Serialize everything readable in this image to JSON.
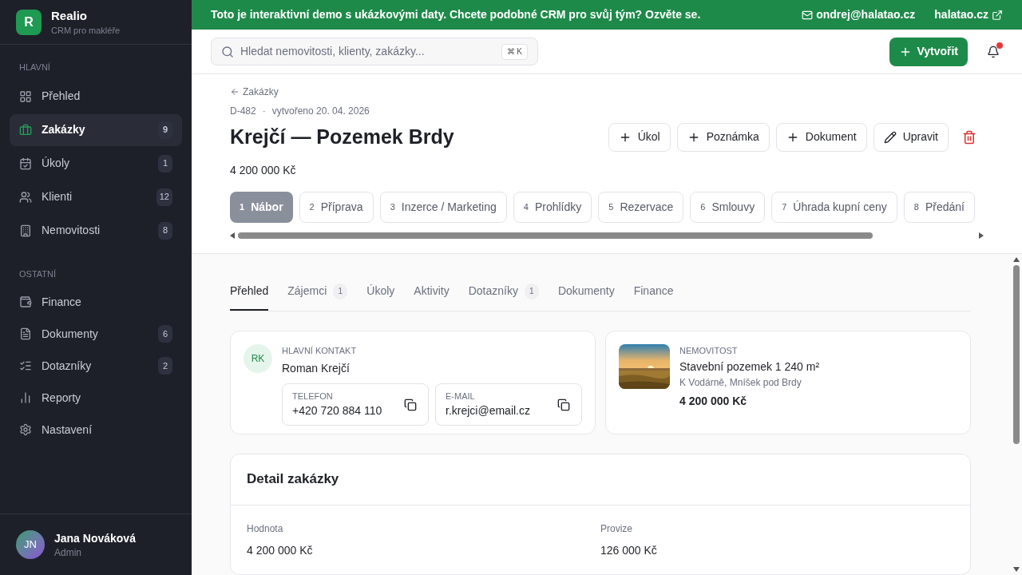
{
  "brand": {
    "logo": "R",
    "name": "Realio",
    "subtitle": "CRM pro makléře"
  },
  "sidebar": [
    {
      "heading": "HLAVNÍ",
      "items": [
        {
          "label": "Přehled",
          "selected": false
        },
        {
          "label": "Zakázky",
          "count": "9",
          "selected": true
        },
        {
          "label": "Úkoly",
          "count": "1",
          "selected": false
        },
        {
          "label": "Klienti",
          "count": "12",
          "selected": false
        },
        {
          "label": "Nemovitosti",
          "count": "8",
          "selected": false
        }
      ]
    },
    {
      "heading": "OSTATNÍ",
      "items": [
        {
          "label": "Finance",
          "selected": false
        },
        {
          "label": "Dokumenty",
          "count": "6",
          "selected": false
        },
        {
          "label": "Dotazníky",
          "count": "2",
          "selected": false
        },
        {
          "label": "Reporty",
          "selected": false
        },
        {
          "label": "Nastavení",
          "selected": false
        }
      ]
    }
  ],
  "user": {
    "initials": "JN",
    "name": "Jana Nováková",
    "role": "Admin"
  },
  "banner": {
    "text": "Toto je interaktivní demo s ukázkovými daty. Chcete podobné CRM pro svůj tým? Ozvěte se.",
    "email": "ondrej@halatao.cz",
    "link": "halatao.cz"
  },
  "search": {
    "placeholder": "Hledat nemovitosti, klienty, zakázky...",
    "shortcut_symbol": "⌘",
    "shortcut_key": "K"
  },
  "create_button": "Vytvořit",
  "notifications": {
    "unread": true
  },
  "breadcrumb": "Zakázky",
  "deal": {
    "id": "D-482",
    "separator": "·",
    "created": "vytvořeno 20. 04. 2026",
    "title": "Krejčí — Pozemek Brdy",
    "price": "4 200 000 Kč"
  },
  "actions": [
    {
      "kind": "add",
      "label": "Úkol"
    },
    {
      "kind": "add",
      "label": "Poznámka"
    },
    {
      "kind": "add",
      "label": "Dokument"
    },
    {
      "kind": "edit",
      "label": "Upravit"
    },
    {
      "kind": "delete"
    }
  ],
  "stages": [
    {
      "number": "1",
      "label": "Nábor",
      "selected": true
    },
    {
      "number": "2",
      "label": "Příprava",
      "selected": false
    },
    {
      "number": "3",
      "label": "Inzerce / Marketing",
      "selected": false
    },
    {
      "number": "4",
      "label": "Prohlídky",
      "selected": false
    },
    {
      "number": "5",
      "label": "Rezervace",
      "selected": false
    },
    {
      "number": "6",
      "label": "Smlouvy",
      "selected": false
    },
    {
      "number": "7",
      "label": "Úhrada kupní ceny",
      "selected": false
    },
    {
      "number": "8",
      "label": "Předání",
      "selected": false
    }
  ],
  "tabs": [
    {
      "label": "Přehled",
      "selected": true
    },
    {
      "label": "Zájemci",
      "count": "1",
      "selected": false
    },
    {
      "label": "Úkoly",
      "selected": false
    },
    {
      "label": "Aktivity",
      "selected": false
    },
    {
      "label": "Dotazníky",
      "count": "1",
      "selected": false
    },
    {
      "label": "Dokumenty",
      "selected": false
    },
    {
      "label": "Finance",
      "selected": false
    }
  ],
  "contact": {
    "initials": "RK",
    "heading": "HLAVNÍ KONTAKT",
    "name": "Roman Krejčí",
    "fields": [
      {
        "label": "TELEFON",
        "value": "+420 720 884 110"
      },
      {
        "label": "E-MAIL",
        "value": "r.krejci@email.cz"
      }
    ]
  },
  "property": {
    "kind": "picture",
    "heading": "NEMOVITOST",
    "title": "Stavební pozemek 1 240 m²",
    "address": "K Vodárně, Mníšek pod Brdy",
    "price": "4 200 000 Kč"
  },
  "detail": {
    "title": "Detail zakázky",
    "fields": [
      {
        "label": "Hodnota",
        "value": "4 200 000 Kč"
      },
      {
        "label": "Provize",
        "value": "126 000 Kč"
      }
    ]
  }
}
